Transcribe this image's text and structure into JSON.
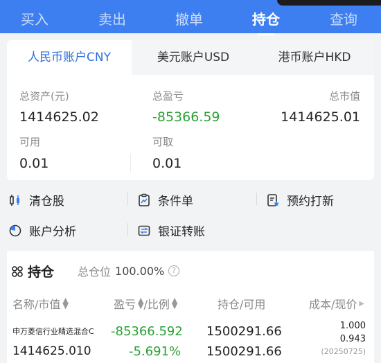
{
  "trade_tabs": [
    "买入",
    "卖出",
    "撤单",
    "持仓",
    "查询"
  ],
  "account_tabs": [
    "人民币账户CNY",
    "美元账户USD",
    "港币账户HKD"
  ],
  "summary": {
    "total_assets_label": "总资产(元)",
    "total_assets": "1414625.02",
    "total_pl_label": "总盈亏",
    "total_pl": "-85366.59",
    "market_value_label": "总市值",
    "market_value": "1414625.01",
    "available_label": "可用",
    "available": "0.01",
    "withdrawable_label": "可取",
    "withdrawable": "0.01"
  },
  "functions": {
    "clear": "清仓股",
    "conditional": "条件单",
    "ipo": "预约打新",
    "analysis": "账户分析",
    "transfer": "银证转账"
  },
  "holdings": {
    "title": "持仓",
    "ratio_label": "总仓位",
    "ratio": "100.00%",
    "columns": [
      "名称/市值",
      "盈亏",
      "/比例",
      "持仓/可用",
      "成本/现价"
    ],
    "rows": [
      {
        "name": "申万菱信行业精选混合C",
        "market_value": "1414625.010",
        "pl": "-85366.592",
        "pl_ratio": "-5.691%",
        "position": "1500291.66",
        "available": "1500291.66",
        "cost": "1.000",
        "price": "0.943",
        "date": "(20250725)"
      }
    ]
  },
  "colors": {
    "primary": "#3d7ff0",
    "active_tab_text": "#2f6fdc",
    "loss_green": "#2aa035",
    "label_gray": "#8a8a8a"
  }
}
